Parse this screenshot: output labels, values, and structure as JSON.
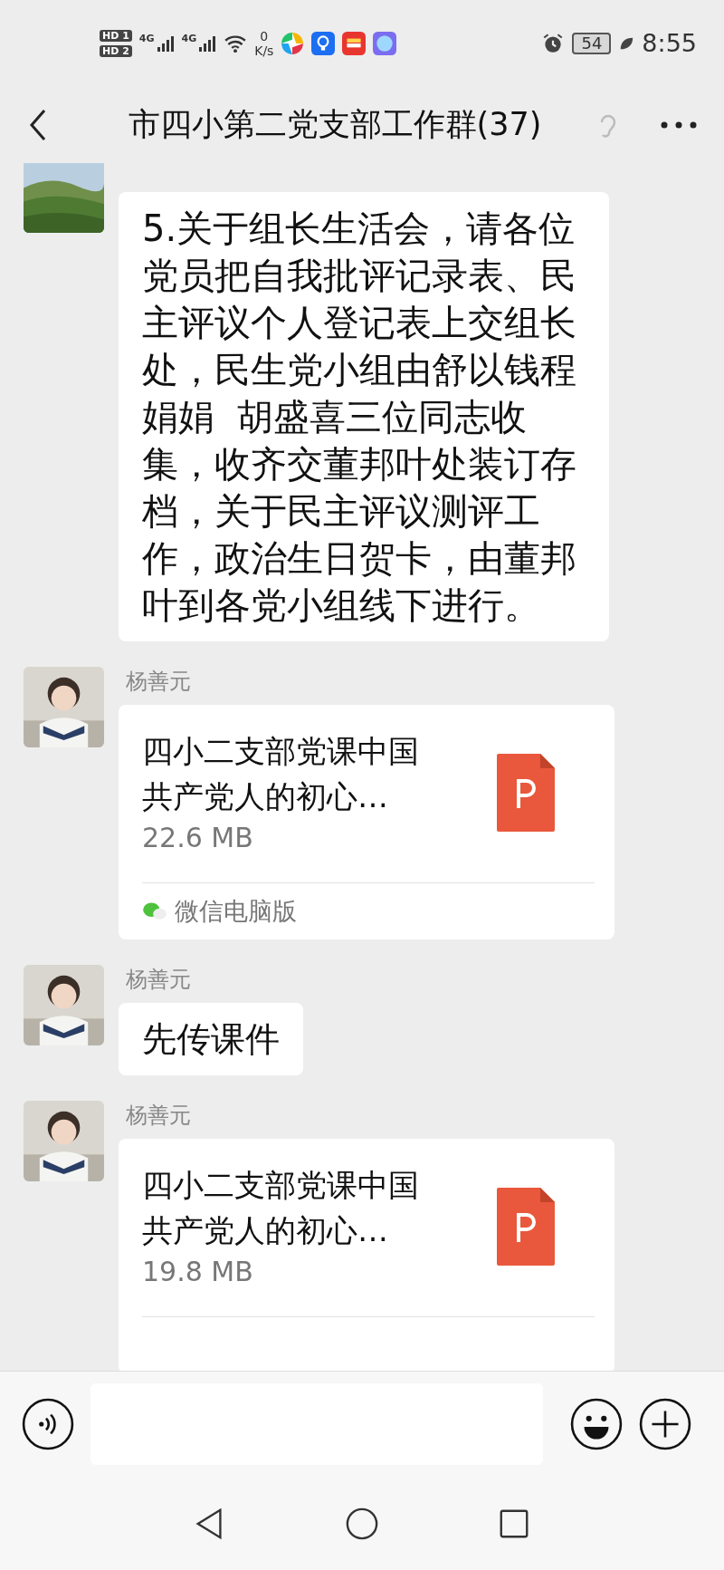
{
  "status_bar": {
    "sim_badges": [
      "HD 1",
      "HD 2"
    ],
    "networks": [
      "4G",
      "4G"
    ],
    "speed_value": "0",
    "speed_unit": "K/s",
    "battery": "54",
    "time": "8:55"
  },
  "header": {
    "title": "市四小第二党支部工作群(37)"
  },
  "messages": [
    {
      "kind": "text",
      "text": "5.关于组长生活会，请各位党员把自我批评记录表、民主评议个人登记表上交组长处，民生党小组由舒以钱程娟娟  胡盛喜三位同志收集，收齐交董邦叶处装订存档，关于民主评议测评工作，政治生日贺卡，由董邦叶到各党小组线下进行。"
    },
    {
      "kind": "file",
      "sender": "杨善元",
      "file_name": "四小二支部党课中国共产党人的初心…",
      "size": "22.6 MB",
      "source": "微信电脑版"
    },
    {
      "kind": "text",
      "sender": "杨善元",
      "text": "先传课件"
    },
    {
      "kind": "file",
      "sender": "杨善元",
      "file_name": "四小二支部党课中国共产党人的初心…",
      "size": "19.8 MB"
    }
  ]
}
